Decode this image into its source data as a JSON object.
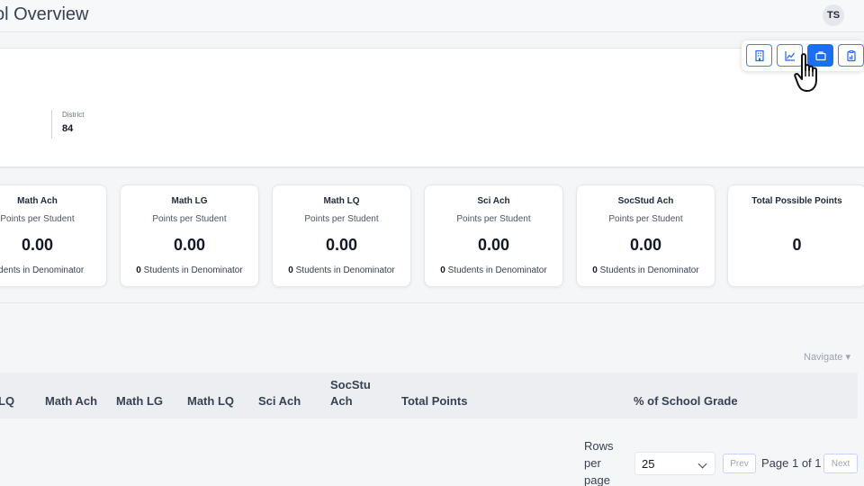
{
  "header": {
    "title": "ol Overview",
    "avatar_initials": "TS"
  },
  "info": {
    "district_label": "District",
    "district_value": "84"
  },
  "view_switcher": {
    "buttons": [
      "building-icon",
      "line-chart-icon",
      "briefcase-icon",
      "clipboard-icon"
    ],
    "active": "briefcase-icon",
    "accent": "#1d6ff2"
  },
  "cards": [
    {
      "title": "Math Ach",
      "sub": "Points per Student",
      "value": "0.00",
      "foot_count": "",
      "foot_text": "tudents in Denominator"
    },
    {
      "title": "Math LG",
      "sub": "Points per Student",
      "value": "0.00",
      "foot_count": "0",
      "foot_text": "Students in Denominator"
    },
    {
      "title": "Math LQ",
      "sub": "Points per Student",
      "value": "0.00",
      "foot_count": "0",
      "foot_text": "Students in Denominator"
    },
    {
      "title": "Sci Ach",
      "sub": "Points per Student",
      "value": "0.00",
      "foot_count": "0",
      "foot_text": "Students in Denominator"
    },
    {
      "title": "SocStud Ach",
      "sub": "Points per Student",
      "value": "0.00",
      "foot_count": "0",
      "foot_text": "Students in Denominator"
    },
    {
      "title": "Total Possible Points",
      "sub": "",
      "value": "0",
      "foot_count": "",
      "foot_text": ""
    }
  ],
  "table": {
    "navigate_label": "Navigate ▾",
    "columns": [
      "LQ",
      "Math Ach",
      "Math LG",
      "Math LQ",
      "Sci Ach",
      "SocStu",
      "Ach",
      "Total Points",
      "% of School Grade"
    ]
  },
  "pagination": {
    "rows_label": [
      "Rows",
      "per",
      "page"
    ],
    "rows_value": "25",
    "prev_label": "Prev",
    "page_info": "Page 1 of 1",
    "next_label": "Next"
  }
}
